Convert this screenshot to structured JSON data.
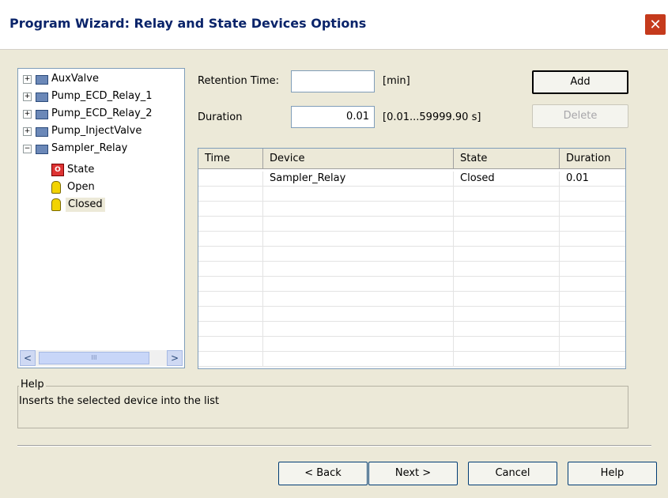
{
  "window": {
    "title": "Program Wizard: Relay and State Devices Options",
    "close_glyph": "✕"
  },
  "tree": {
    "nodes": [
      {
        "label": "AuxValve",
        "expander": "+"
      },
      {
        "label": "Pump_ECD_Relay_1",
        "expander": "+"
      },
      {
        "label": "Pump_ECD_Relay_2",
        "expander": "+"
      },
      {
        "label": "Pump_InjectValve",
        "expander": "+"
      },
      {
        "label": "Sampler_Relay",
        "expander": "−"
      }
    ],
    "children": [
      {
        "label": "State",
        "icon": "state-icon"
      },
      {
        "label": "Open",
        "icon": "relay-open-icon"
      },
      {
        "label": "Closed",
        "icon": "relay-closed-icon",
        "selected": true
      }
    ],
    "scroll_left": "<",
    "scroll_right": ">",
    "scroll_grip": "III"
  },
  "form": {
    "retention_label": "Retention Time:",
    "retention_value": "",
    "retention_unit": "[min]",
    "duration_label": "Duration",
    "duration_value": "0.01",
    "duration_range": "[0.01...59999.90 s]"
  },
  "buttons": {
    "add": "Add",
    "delete": "Delete",
    "back": "< Back",
    "next": "Next >",
    "cancel": "Cancel",
    "help": "Help"
  },
  "grid": {
    "columns": [
      "Time",
      "Device",
      "State",
      "Duration"
    ],
    "rows": [
      [
        "",
        "Sampler_Relay",
        "Closed",
        "0.01"
      ]
    ]
  },
  "help": {
    "legend": "Help",
    "text": "Inserts the selected device into the list"
  },
  "colors": {
    "accent": "#0a246a",
    "selection": "#ece9d8",
    "close": "#c53a1c"
  }
}
